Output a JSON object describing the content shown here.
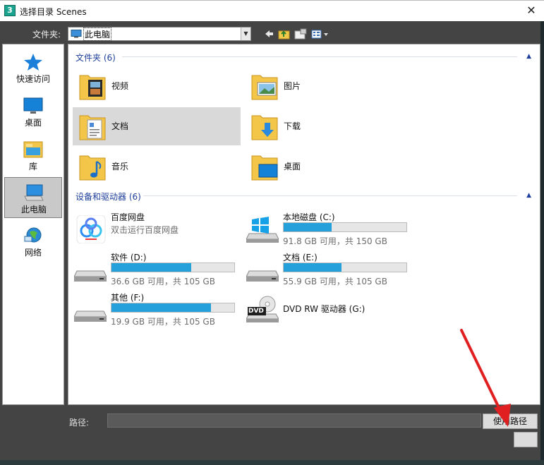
{
  "window": {
    "title": "选择目录 Scenes",
    "app_icon_text": "3"
  },
  "folder_row": {
    "label": "文件夹:",
    "current": "此电脑"
  },
  "nav": [
    {
      "label": "快速访问",
      "icon": "star-icon"
    },
    {
      "label": "桌面",
      "icon": "desktop-icon"
    },
    {
      "label": "库",
      "icon": "library-icon"
    },
    {
      "label": "此电脑",
      "icon": "computer-icon",
      "selected": true
    },
    {
      "label": "网络",
      "icon": "network-icon"
    }
  ],
  "groups": {
    "folders": {
      "header": "文件夹 (6)"
    },
    "devices": {
      "header": "设备和驱动器 (6)"
    }
  },
  "folders": [
    {
      "name": "视频",
      "icon": "video-folder-icon"
    },
    {
      "name": "图片",
      "icon": "pictures-folder-icon"
    },
    {
      "name": "文档",
      "icon": "documents-folder-icon",
      "selected": true
    },
    {
      "name": "下载",
      "icon": "downloads-folder-icon"
    },
    {
      "name": "音乐",
      "icon": "music-folder-icon"
    },
    {
      "name": "桌面",
      "icon": "desktop-folder-icon"
    }
  ],
  "baidu": {
    "name": "百度网盘",
    "subtitle": "双击运行百度网盘"
  },
  "drives": [
    {
      "name": "本地磁盘 (C:)",
      "free": "91.8 GB 可用，共 150 GB",
      "used_fraction": 0.39
    },
    {
      "name": "软件 (D:)",
      "free": "36.6 GB 可用，共 105 GB",
      "used_fraction": 0.65
    },
    {
      "name": "文档 (E:)",
      "free": "55.9 GB 可用，共 105 GB",
      "used_fraction": 0.47
    },
    {
      "name": "其他 (F:)",
      "free": "19.9 GB 可用，共 105 GB",
      "used_fraction": 0.81
    }
  ],
  "dvd": {
    "name": "DVD RW 驱动器 (G:)",
    "badge": "DVD"
  },
  "path_row": {
    "label": "路径:",
    "value": "",
    "use_path_label": "使用路径"
  },
  "colors": {
    "accent": "#26a0da",
    "header": "#1e3f9b",
    "annotation": "#e02020"
  }
}
